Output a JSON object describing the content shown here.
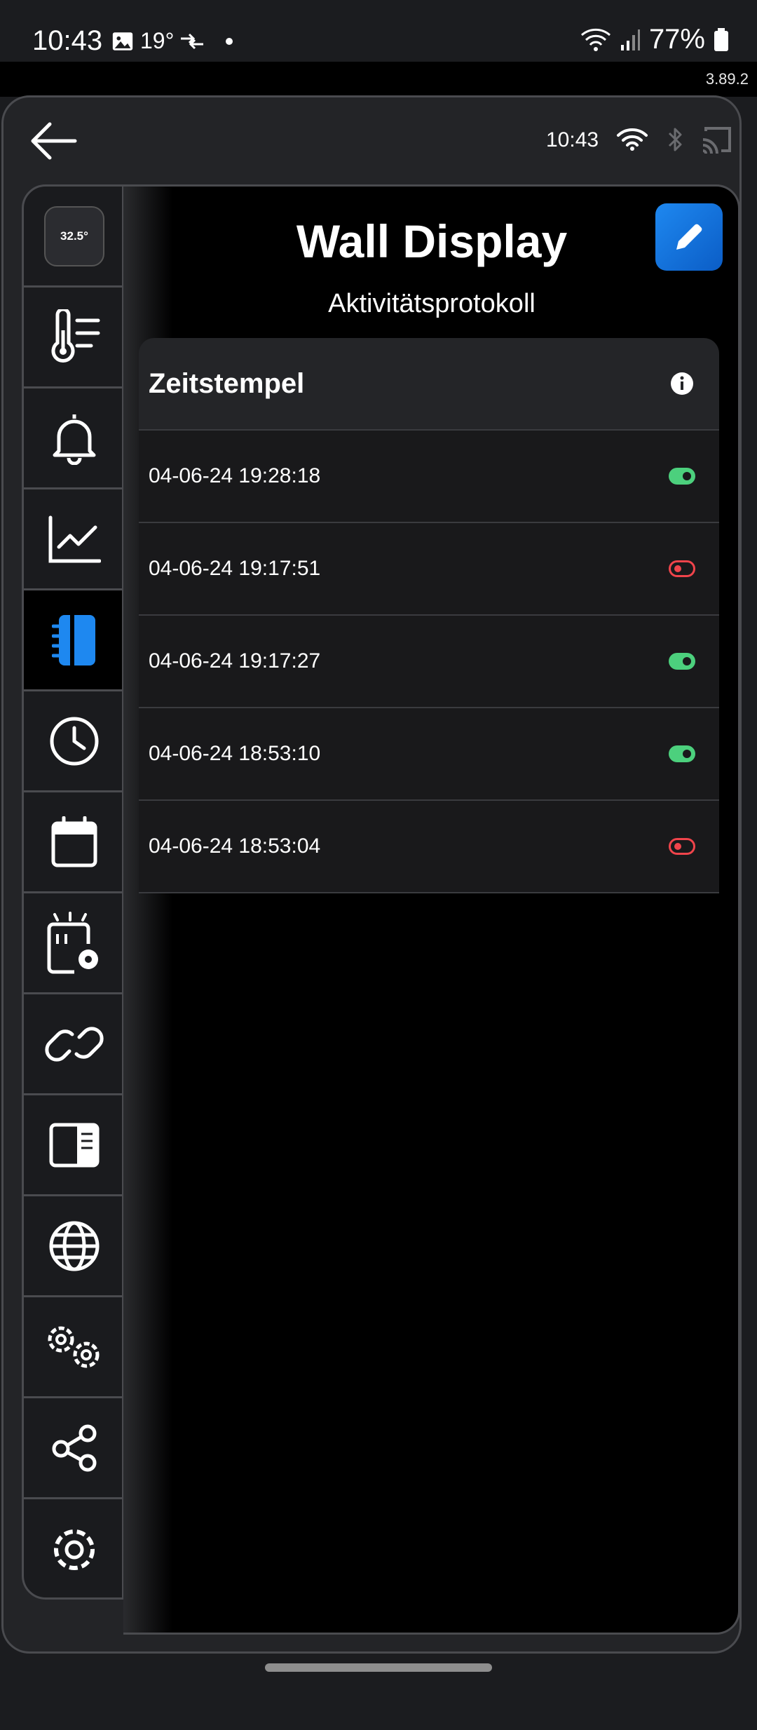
{
  "statusbar": {
    "time": "10:43",
    "temperature": "19°",
    "battery": "77%"
  },
  "version": "3.89.2",
  "topbar": {
    "time": "10:43"
  },
  "sidebar": {
    "items": [
      {
        "name": "thumbnail",
        "icon": "device-thumbnail-icon",
        "active": false
      },
      {
        "name": "sensors",
        "icon": "thermometer-list-icon",
        "active": false
      },
      {
        "name": "notifications",
        "icon": "bell-icon",
        "active": false
      },
      {
        "name": "charts",
        "icon": "line-chart-icon",
        "active": false
      },
      {
        "name": "activity-log",
        "icon": "notebook-icon",
        "active": true
      },
      {
        "name": "timers",
        "icon": "clock-icon",
        "active": false
      },
      {
        "name": "schedule",
        "icon": "calendar-icon",
        "active": false
      },
      {
        "name": "scenes",
        "icon": "device-settings-icon",
        "active": false
      },
      {
        "name": "links",
        "icon": "chain-link-icon",
        "active": false
      },
      {
        "name": "layout",
        "icon": "panel-layout-icon",
        "active": false
      },
      {
        "name": "web",
        "icon": "globe-icon",
        "active": false
      },
      {
        "name": "advanced-settings",
        "icon": "gears-icon",
        "active": false
      },
      {
        "name": "share",
        "icon": "share-icon",
        "active": false
      },
      {
        "name": "settings",
        "icon": "gear-icon",
        "active": false
      }
    ],
    "thumbnail_text": "32.5°"
  },
  "main": {
    "title": "Wall Display",
    "subtitle": "Aktivitätsprotokoll",
    "table": {
      "header": "Zeitstempel",
      "rows": [
        {
          "timestamp": "04-06-24 19:28:18",
          "state": "on"
        },
        {
          "timestamp": "04-06-24 19:17:51",
          "state": "off"
        },
        {
          "timestamp": "04-06-24 19:17:27",
          "state": "on"
        },
        {
          "timestamp": "04-06-24 18:53:10",
          "state": "on"
        },
        {
          "timestamp": "04-06-24 18:53:04",
          "state": "off"
        }
      ]
    }
  },
  "colors": {
    "accent": "#1e88f0",
    "on": "#4cd07d",
    "off": "#f0444b"
  }
}
